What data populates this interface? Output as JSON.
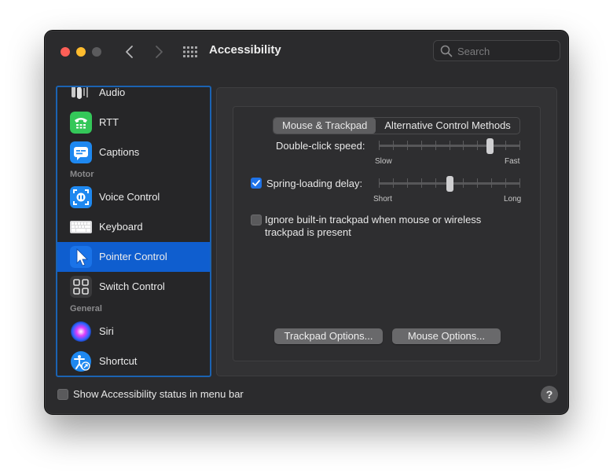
{
  "window": {
    "title": "Accessibility",
    "search_placeholder": "Search"
  },
  "sidebar": {
    "items": [
      {
        "label": "Audio",
        "icon": "audio-icon"
      },
      {
        "label": "RTT",
        "icon": "rtt-icon"
      },
      {
        "label": "Captions",
        "icon": "captions-icon"
      },
      {
        "label": "Voice Control",
        "icon": "voice-control-icon"
      },
      {
        "label": "Keyboard",
        "icon": "keyboard-icon"
      },
      {
        "label": "Pointer Control",
        "icon": "pointer-icon",
        "selected": true
      },
      {
        "label": "Switch Control",
        "icon": "switch-control-icon"
      },
      {
        "label": "Siri",
        "icon": "siri-icon"
      },
      {
        "label": "Shortcut",
        "icon": "shortcut-icon"
      }
    ],
    "headers": [
      "Motor",
      "General"
    ]
  },
  "tabs": [
    "Mouse & Trackpad",
    "Alternative Control Methods"
  ],
  "settings": {
    "double_click_label": "Double-click speed:",
    "double_click_min": "Slow",
    "double_click_max": "Fast",
    "double_click_value": 0.8,
    "spring_label": "Spring-loading delay:",
    "spring_checked": true,
    "spring_min": "Short",
    "spring_max": "Long",
    "spring_value": 0.5,
    "ignore_trackpad_line1": "Ignore built-in trackpad when mouse or wireless",
    "ignore_trackpad_line2": "trackpad is present",
    "ignore_trackpad_checked": false
  },
  "buttons": {
    "trackpad_options": "Trackpad Options...",
    "mouse_options": "Mouse Options..."
  },
  "footer": {
    "status_label": "Show Accessibility status in menu bar",
    "status_checked": false,
    "help": "?"
  },
  "colors": {
    "accent": "#0f5ecf",
    "sidebar_border": "#1b63b2",
    "checkbox_on": "#1f73e8"
  }
}
